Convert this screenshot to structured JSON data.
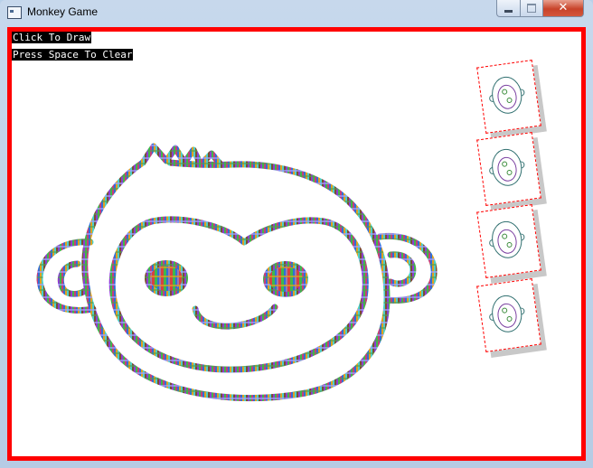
{
  "window": {
    "title": "Monkey Game",
    "close_glyph": "✕"
  },
  "canvas": {
    "border_color": "#ff0000",
    "background": "#ffffff",
    "instructions": [
      "Click To Draw",
      "Press Space To Clear"
    ]
  },
  "drawing": {
    "subject": "monkey-face",
    "stroke_style": "multicolor-pixel-brush",
    "palette": [
      "#8b3fd1",
      "#3fb84a",
      "#c43f7a",
      "#2f6fd8",
      "#e0a020",
      "#4ad0c8",
      "#7a5030",
      "#a0a0ff",
      "#d84040",
      "#50a050"
    ]
  },
  "thumbnails": {
    "count": 4,
    "card_border_color": "#ff0000",
    "stroke_colors": [
      "#2f6f6f",
      "#7a3fa0",
      "#3f8f3f"
    ]
  }
}
